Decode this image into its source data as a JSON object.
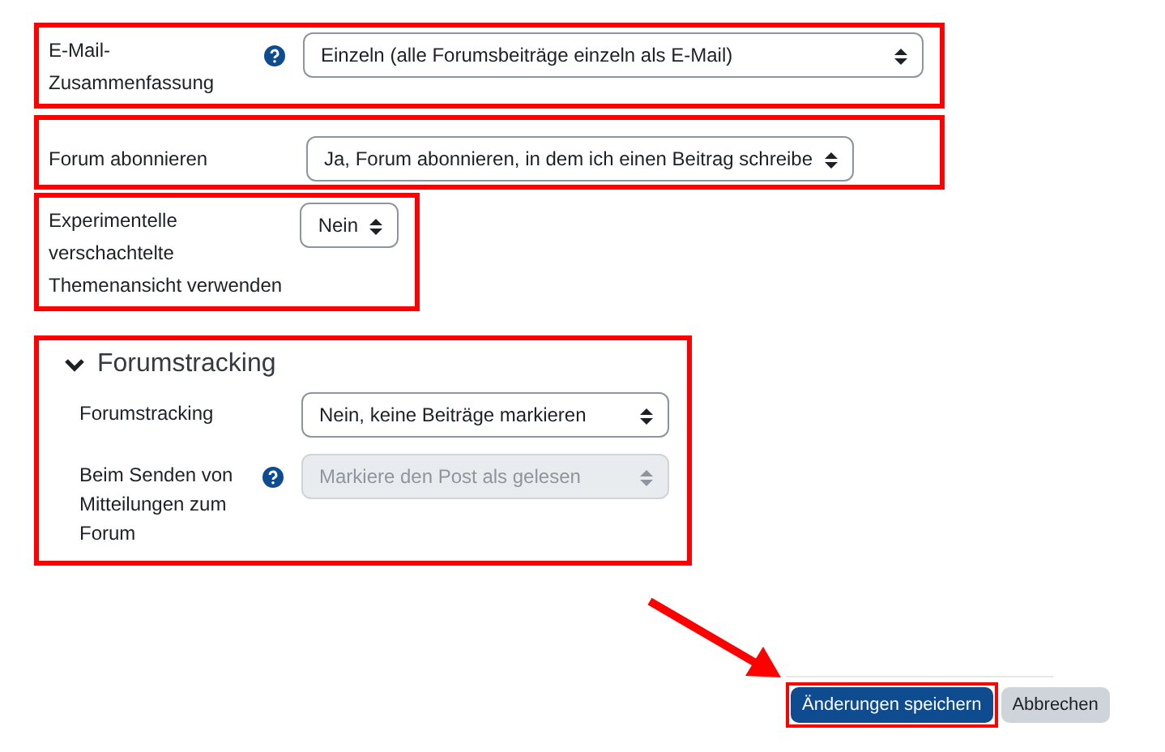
{
  "rows": [
    {
      "label": "E-Mail-Zusammenfassung",
      "help": true,
      "value": "Einzeln (alle Forumsbeiträge einzeln als E-Mail)",
      "disabled": false,
      "highlighted": true
    },
    {
      "label": "Forum abonnieren",
      "help": false,
      "value": "Ja, Forum abonnieren, in dem ich einen Beitrag schreibe",
      "disabled": false,
      "highlighted": true
    },
    {
      "label": "Experimentelle verschachtelte Themenansicht verwenden",
      "help": false,
      "value": "Nein",
      "disabled": false,
      "highlighted": true
    }
  ],
  "section": {
    "title": "Forumstracking",
    "expanded": true,
    "highlighted": true,
    "rows": [
      {
        "label": "Forumstracking",
        "help": false,
        "value": "Nein, keine Beiträge markieren",
        "disabled": false
      },
      {
        "label": "Beim Senden von Mitteilungen zum Forum",
        "help": true,
        "value": "Markiere den Post als gelesen",
        "disabled": true
      }
    ]
  },
  "buttons": [
    {
      "label": "Änderungen speichern",
      "kind": "primary",
      "highlighted": true
    },
    {
      "label": "Abbrechen",
      "kind": "secondary",
      "highlighted": false
    }
  ]
}
